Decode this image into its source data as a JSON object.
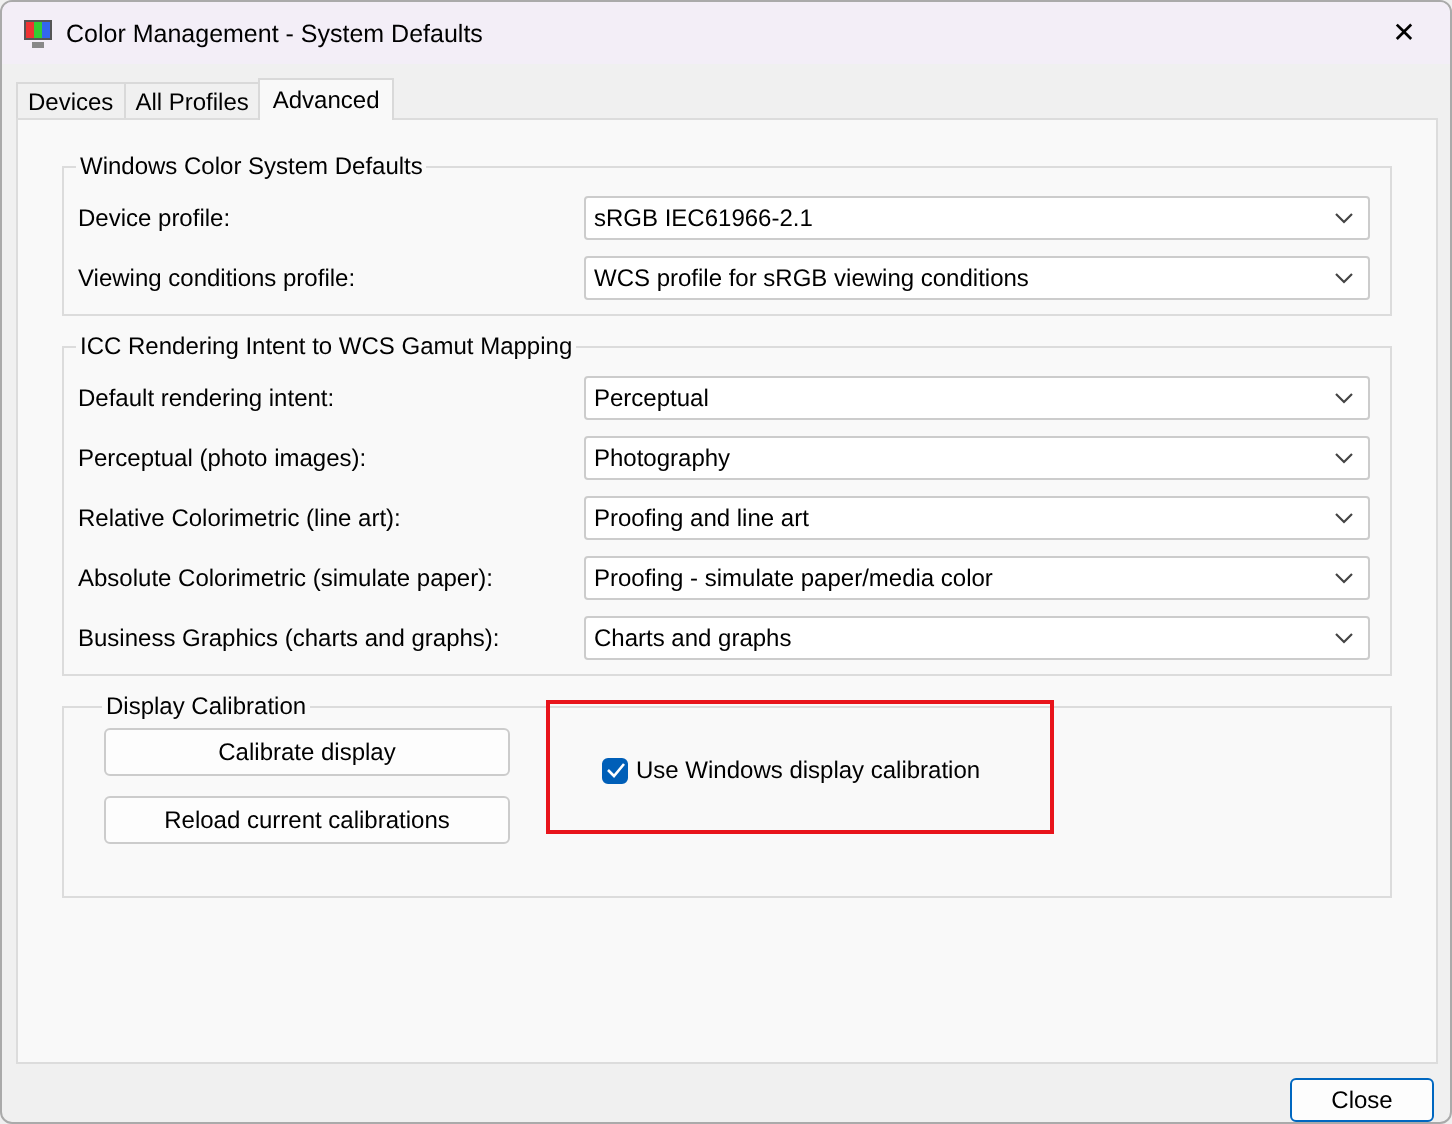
{
  "window": {
    "title": "Color Management - System Defaults",
    "close_glyph": "✕"
  },
  "tabs": [
    {
      "label": "Devices",
      "selected": false
    },
    {
      "label": "All Profiles",
      "selected": false
    },
    {
      "label": "Advanced",
      "selected": true
    }
  ],
  "groups": [
    {
      "title": "Windows Color System Defaults",
      "rows": [
        {
          "label": "Device profile:",
          "value": "sRGB IEC61966-2.1"
        },
        {
          "label": "Viewing conditions profile:",
          "value": "WCS profile for sRGB viewing conditions"
        }
      ]
    },
    {
      "title": "ICC Rendering Intent to WCS Gamut Mapping",
      "rows": [
        {
          "label": "Default rendering intent:",
          "value": "Perceptual"
        },
        {
          "label": "Perceptual (photo images):",
          "value": "Photography"
        },
        {
          "label": "Relative Colorimetric (line art):",
          "value": "Proofing and line art"
        },
        {
          "label": "Absolute Colorimetric (simulate paper):",
          "value": "Proofing - simulate paper/media color"
        },
        {
          "label": "Business Graphics (charts and graphs):",
          "value": "Charts and graphs"
        }
      ]
    }
  ],
  "calibration": {
    "title": "Display Calibration",
    "buttons": [
      "Calibrate display",
      "Reload current calibrations"
    ],
    "checkbox": {
      "label": "Use Windows display calibration",
      "checked": true,
      "highlighted": true
    }
  },
  "footer_buttons": [
    "Close"
  ]
}
